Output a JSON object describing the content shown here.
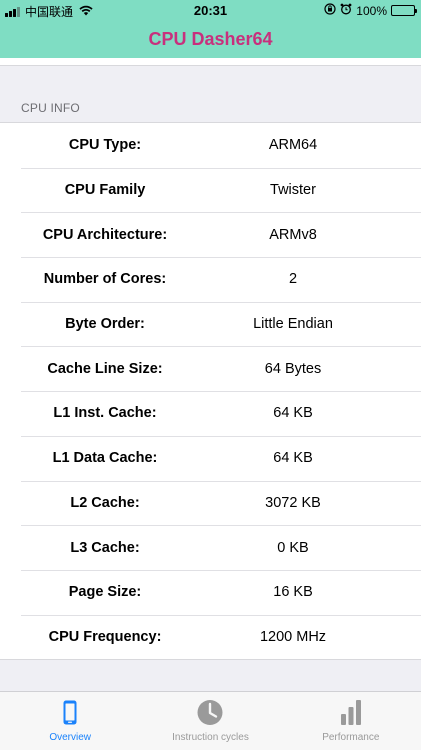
{
  "status_bar": {
    "carrier": "中国联通",
    "time": "20:31",
    "battery": "100%"
  },
  "nav": {
    "title": "CPU Dasher64"
  },
  "section": {
    "header": "CPU INFO"
  },
  "rows": [
    {
      "label": "CPU Type:",
      "value": "ARM64"
    },
    {
      "label": "CPU Family",
      "value": "Twister"
    },
    {
      "label": "CPU Architecture:",
      "value": "ARMv8"
    },
    {
      "label": "Number of Cores:",
      "value": "2"
    },
    {
      "label": "Byte Order:",
      "value": "Little Endian"
    },
    {
      "label": "Cache Line Size:",
      "value": "64 Bytes"
    },
    {
      "label": "L1 Inst. Cache:",
      "value": "64 KB"
    },
    {
      "label": "L1 Data Cache:",
      "value": "64 KB"
    },
    {
      "label": "L2 Cache:",
      "value": "3072 KB"
    },
    {
      "label": "L3 Cache:",
      "value": "0 KB"
    },
    {
      "label": "Page Size:",
      "value": "16 KB"
    },
    {
      "label": "CPU Frequency:",
      "value": "1200 MHz"
    }
  ],
  "tabs": [
    {
      "label": "Overview",
      "icon": "phone-icon",
      "active": true
    },
    {
      "label": "Instruction cycles",
      "icon": "clock-icon",
      "active": false
    },
    {
      "label": "Performance",
      "icon": "bar-chart-icon",
      "active": false
    }
  ],
  "colors": {
    "accent_bar": "#7fddc3",
    "title": "#c8307d",
    "tab_active": "#1a82fb",
    "tab_inactive": "#9a9a9a"
  }
}
